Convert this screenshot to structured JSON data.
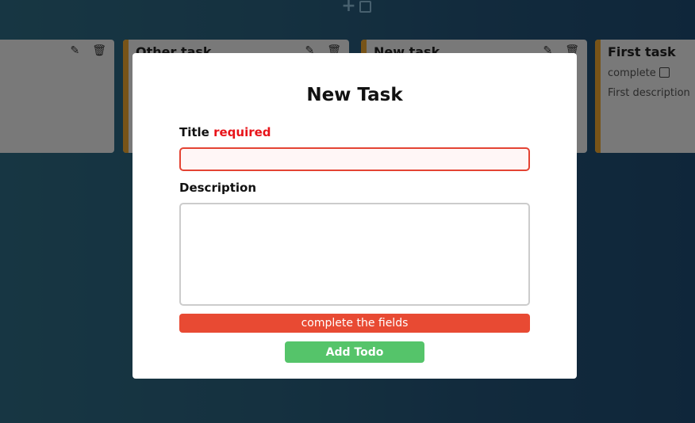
{
  "header": {
    "add_button_plus": "+"
  },
  "cards": [
    {
      "title": "",
      "show_stripe": false
    },
    {
      "title": "Other task"
    },
    {
      "title": "New task"
    },
    {
      "title": "First task",
      "complete_label": "complete",
      "description": "First description"
    }
  ],
  "modal": {
    "heading": "New Task",
    "title_label": "Title",
    "title_required": "required",
    "title_value": "",
    "description_label": "Description",
    "description_value": "",
    "error_message": "complete the fields",
    "add_button": "Add Todo"
  },
  "colors": {
    "accent_stripe": "#f0a830",
    "error": "#e84a33",
    "required_text": "#e8141a",
    "submit": "#55c46a"
  }
}
